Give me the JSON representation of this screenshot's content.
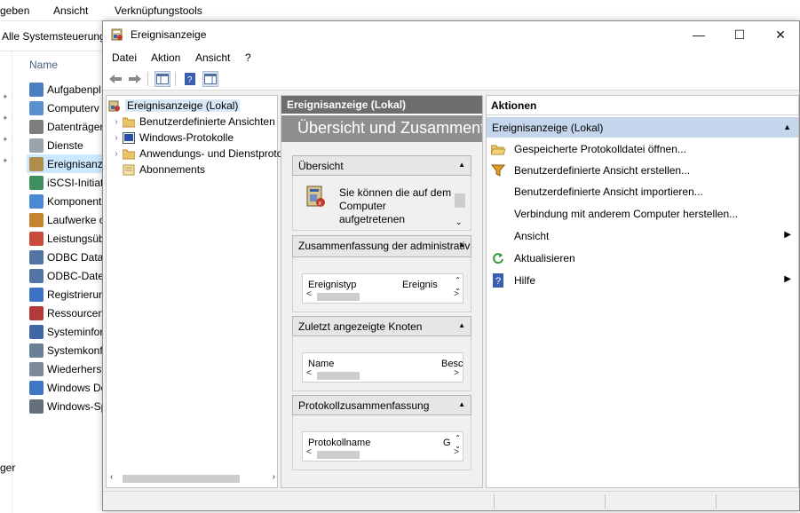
{
  "background": {
    "ribbon": [
      "geben",
      "Ansicht",
      "Verknüpfungstools"
    ],
    "address": "Alle Systemsteuerung",
    "column_header": "Name",
    "items": [
      {
        "label": "Aufgabenpl",
        "color": "#4a7fc1"
      },
      {
        "label": "Computerv",
        "color": "#5b8fd0"
      },
      {
        "label": "Datenträger",
        "color": "#7d7d7d"
      },
      {
        "label": "Dienste",
        "color": "#9aa4ad"
      },
      {
        "label": "Ereignisanze",
        "color": "#b08d4a"
      },
      {
        "label": "iSCSI-Initiat",
        "color": "#3d8f5d"
      },
      {
        "label": "Komponent",
        "color": "#4b8ad3"
      },
      {
        "label": "Laufwerke o",
        "color": "#c7822d"
      },
      {
        "label": "Leistungsüb",
        "color": "#c84b3b"
      },
      {
        "label": "ODBC Data",
        "color": "#5574a6"
      },
      {
        "label": "ODBC-Date",
        "color": "#5574a6"
      },
      {
        "label": "Registrierun",
        "color": "#3b72c4"
      },
      {
        "label": "Ressourcen",
        "color": "#b33a3a"
      },
      {
        "label": "Systeminfor",
        "color": "#4166a6"
      },
      {
        "label": "Systemkonf",
        "color": "#6b7f96"
      },
      {
        "label": "Wiederherst",
        "color": "#7b8a99"
      },
      {
        "label": "Windows Do",
        "color": "#3f77c6"
      },
      {
        "label": "Windows-Sp",
        "color": "#66707a"
      }
    ],
    "bottom_text": "ger"
  },
  "window": {
    "title": "Ereignisanzeige",
    "controls": {
      "minimize": "—",
      "maximize": "☐",
      "close": "✕"
    },
    "menu": [
      "Datei",
      "Aktion",
      "Ansicht",
      "?"
    ]
  },
  "tree": {
    "root": "Ereignisanzeige (Lokal)",
    "children": [
      {
        "label": "Benutzerdefinierte Ansichten",
        "expander": "›"
      },
      {
        "label": "Windows-Protokolle",
        "expander": "›"
      },
      {
        "label": "Anwendungs- und Dienstprotokolle",
        "expander": "›"
      },
      {
        "label": "Abonnements",
        "expander": ""
      }
    ]
  },
  "middle": {
    "header": "Ereignisanzeige (Lokal)",
    "banner": "Übersicht und Zusammenfassung",
    "sections": {
      "overview": {
        "title": "Übersicht",
        "text": "Sie können die auf dem Computer aufgetretenen Ereignisse anzeigen"
      },
      "summary": {
        "title": "Zusammenfassung der administrativen Ereignisse",
        "col1": "Ereignistyp",
        "col2": "Ereignis"
      },
      "recent": {
        "title": "Zuletzt angezeigte Knoten",
        "col1": "Name",
        "col2": "Besc"
      },
      "logsummary": {
        "title": "Protokollzusammenfassung",
        "col1": "Protokollname",
        "col2": "G"
      }
    }
  },
  "actions": {
    "header": "Aktionen",
    "sub": "Ereignisanzeige (Lokal)",
    "items": [
      {
        "label": "Gespeicherte Protokolldatei öffnen...",
        "icon": "open-folder-icon",
        "submenu": false
      },
      {
        "label": "Benutzerdefinierte Ansicht erstellen...",
        "icon": "filter-icon",
        "submenu": false
      },
      {
        "label": "Benutzerdefinierte Ansicht importieren...",
        "icon": "",
        "submenu": false
      },
      {
        "label": "Verbindung mit anderem Computer herstellen...",
        "icon": "",
        "submenu": false
      },
      {
        "label": "Ansicht",
        "icon": "",
        "submenu": true
      },
      {
        "label": "Aktualisieren",
        "icon": "refresh-icon",
        "submenu": false
      },
      {
        "label": "Hilfe",
        "icon": "help-icon",
        "submenu": true
      }
    ]
  },
  "colors": {
    "accent_selection": "#c5d6ec",
    "header_dark": "#6d6d6d",
    "banner_gray": "#8f8f8f"
  }
}
